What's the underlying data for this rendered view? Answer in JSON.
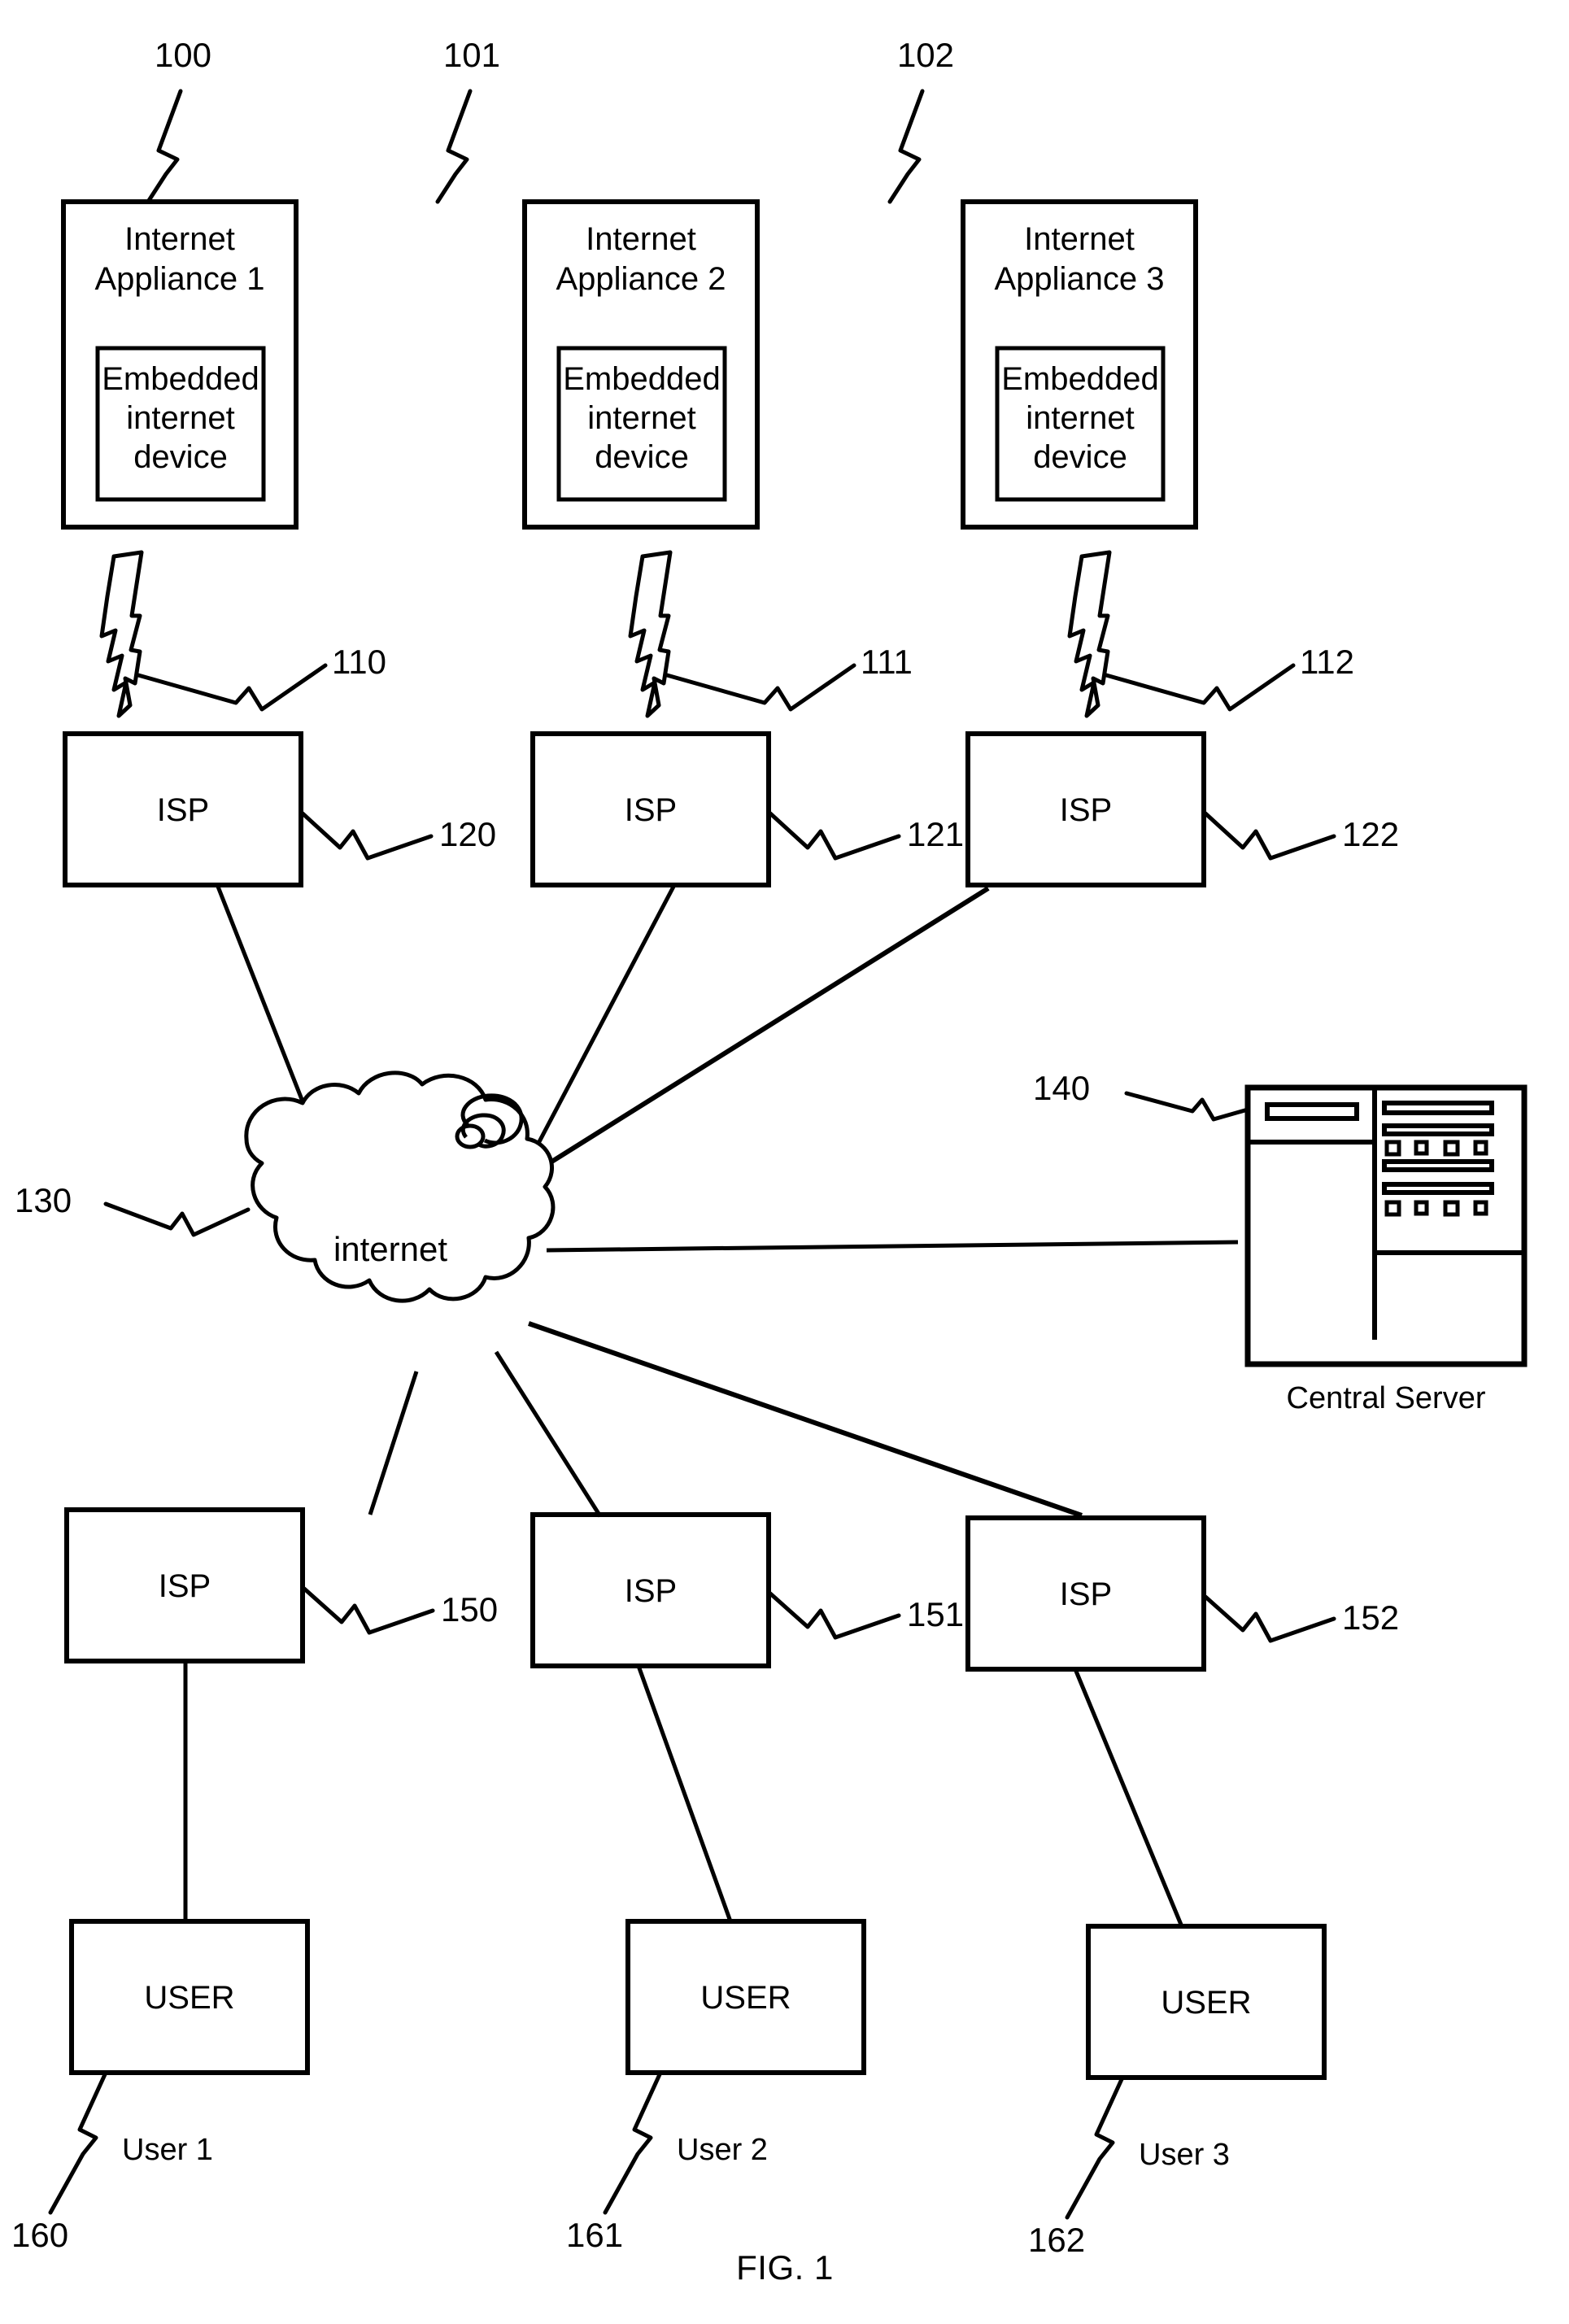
{
  "figure": {
    "caption": "FIG. 1",
    "cloud_label": "internet",
    "server_caption": "Central Server"
  },
  "appliances": [
    {
      "ref": "100",
      "title_line1": "Internet",
      "title_line2": "Appliance 1",
      "inner_line1": "Embedded",
      "inner_line2": "internet",
      "inner_line3": "device"
    },
    {
      "ref": "101",
      "title_line1": "Internet",
      "title_line2": "Appliance 2",
      "inner_line1": "Embedded",
      "inner_line2": "internet",
      "inner_line3": "device"
    },
    {
      "ref": "102",
      "title_line1": "Internet",
      "title_line2": "Appliance 3",
      "inner_line1": "Embedded",
      "inner_line2": "internet",
      "inner_line3": "device"
    }
  ],
  "wireless_links": [
    {
      "ref": "110",
      "icon": "lightning-bolt-icon"
    },
    {
      "ref": "111",
      "icon": "lightning-bolt-icon"
    },
    {
      "ref": "112",
      "icon": "lightning-bolt-icon"
    }
  ],
  "upper_isps": [
    {
      "label": "ISP",
      "ref": "120"
    },
    {
      "label": "ISP",
      "ref": "121"
    },
    {
      "label": "ISP",
      "ref": "122"
    }
  ],
  "network": {
    "label": "internet",
    "ref": "130",
    "icon": "cloud-icon"
  },
  "central_server": {
    "ref": "140",
    "caption": "Central Server",
    "icon": "server-tower-icon"
  },
  "lower_isps": [
    {
      "label": "ISP",
      "ref": "150"
    },
    {
      "label": "ISP",
      "ref": "151"
    },
    {
      "label": "ISP",
      "ref": "152"
    }
  ],
  "users": [
    {
      "label": "USER",
      "caption": "User 1",
      "ref": "160"
    },
    {
      "label": "USER",
      "caption": "User 2",
      "ref": "161"
    },
    {
      "label": "USER",
      "caption": "User 3",
      "ref": "162"
    }
  ],
  "colors": {
    "stroke": "#000000",
    "background": "#ffffff"
  }
}
